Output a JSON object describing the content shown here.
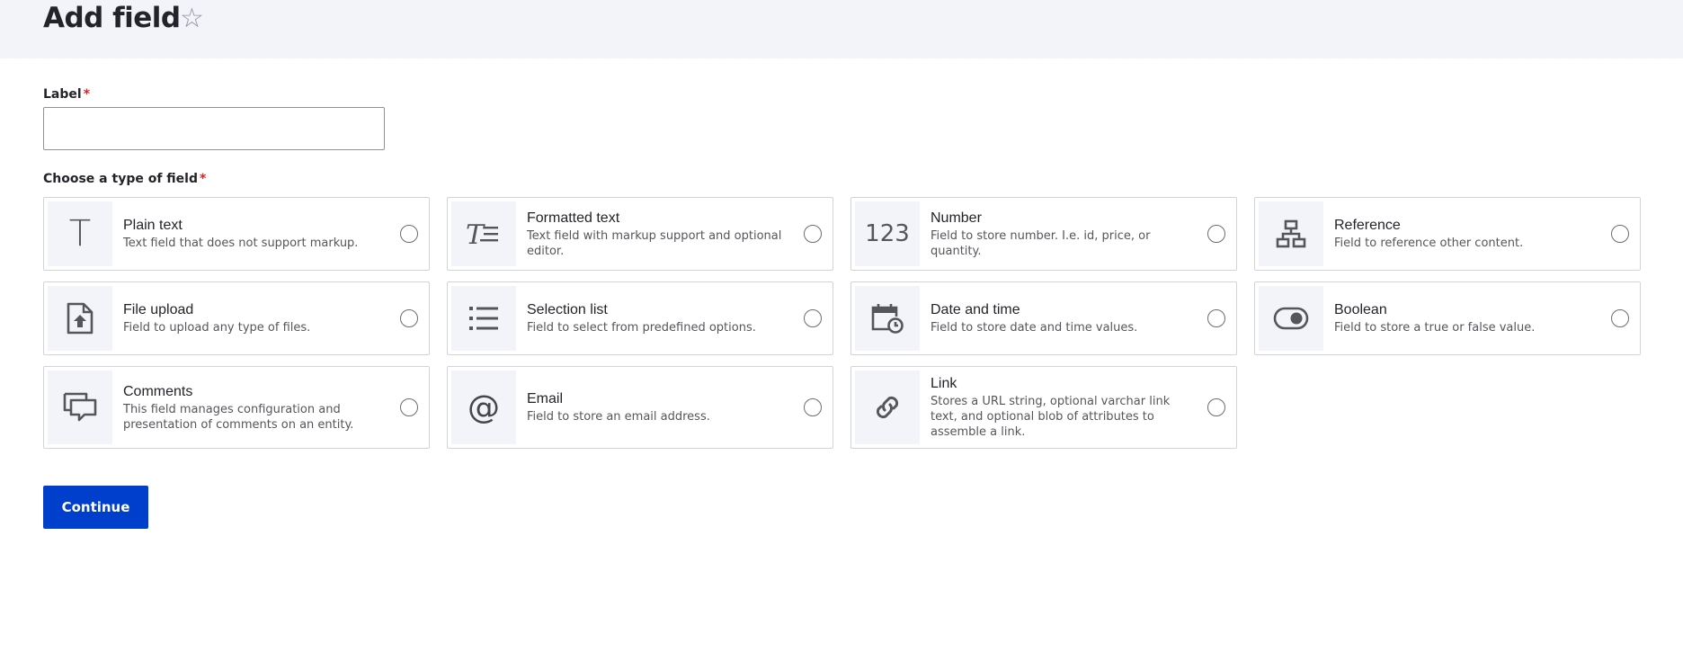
{
  "page": {
    "title": "Add field",
    "favorite_icon": "star-outline-icon"
  },
  "form": {
    "label_field": {
      "label": "Label",
      "required_marker": "*",
      "value": "",
      "placeholder": ""
    },
    "field_type": {
      "label": "Choose a type of field",
      "required_marker": "*"
    },
    "continue_label": "Continue"
  },
  "field_types": [
    {
      "id": "plain-text",
      "title": "Plain text",
      "description": "Text field that does not support markup.",
      "icon": "plain-text-icon",
      "icon_glyph": "T",
      "selected": false
    },
    {
      "id": "formatted-text",
      "title": "Formatted text",
      "description": "Text field with markup support and optional editor.",
      "icon": "formatted-text-icon",
      "selected": false
    },
    {
      "id": "number",
      "title": "Number",
      "description": "Field to store number. I.e. id, price, or quantity.",
      "icon": "number-icon",
      "icon_glyph": "123",
      "selected": false
    },
    {
      "id": "reference",
      "title": "Reference",
      "description": "Field to reference other content.",
      "icon": "reference-icon",
      "selected": false
    },
    {
      "id": "file-upload",
      "title": "File upload",
      "description": "Field to upload any type of files.",
      "icon": "file-upload-icon",
      "selected": false
    },
    {
      "id": "selection-list",
      "title": "Selection list",
      "description": "Field to select from predefined options.",
      "icon": "selection-list-icon",
      "selected": false
    },
    {
      "id": "date-and-time",
      "title": "Date and time",
      "description": "Field to store date and time values.",
      "icon": "calendar-clock-icon",
      "selected": false
    },
    {
      "id": "boolean",
      "title": "Boolean",
      "description": "Field to store a true or false value.",
      "icon": "toggle-icon",
      "selected": false
    },
    {
      "id": "comments",
      "title": "Comments",
      "description": "This field manages configuration and presentation of comments on an entity.",
      "icon": "comments-icon",
      "selected": false
    },
    {
      "id": "email",
      "title": "Email",
      "description": "Field to store an email address.",
      "icon": "email-at-icon",
      "icon_glyph": "@",
      "selected": false
    },
    {
      "id": "link",
      "title": "Link",
      "description": "Stores a URL string, optional varchar link text, and optional blob of attributes to assemble a link.",
      "icon": "link-icon",
      "selected": false
    }
  ],
  "colors": {
    "header_bg": "#f3f4f9",
    "primary": "#003ecc",
    "required": "#dc2323",
    "icon_bg": "#f3f4f9"
  }
}
